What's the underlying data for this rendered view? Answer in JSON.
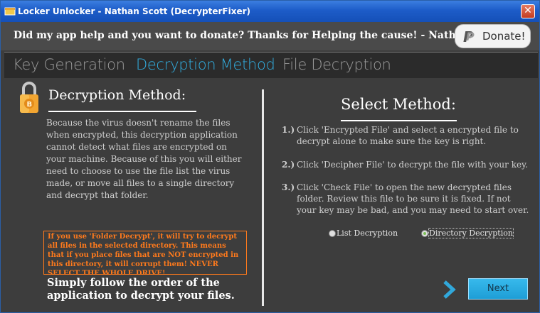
{
  "window": {
    "title": "Locker Unlocker - Nathan Scott (DecrypterFixer)",
    "close_label": "✕"
  },
  "banner": {
    "text": "Did my app help and you want to donate? Thanks for Helping the cause! - Nathan Scott",
    "donate_label": "Donate!"
  },
  "tabs": [
    {
      "label": "Key Generation",
      "active": false
    },
    {
      "label": "Decryption Method",
      "active": true
    },
    {
      "label": "File Decryption",
      "active": false
    }
  ],
  "left": {
    "heading": "Decryption Method:",
    "description": "Because the virus doesn't rename the files when encrypted, this decryption application cannot detect what files are encrypted on your machine. Because of this you will either need to choose to use the file list the virus made, or move all files to a single directory and decrypt that folder.",
    "warning": "If you use 'Folder Decrypt', it will try to decrypt all files in the selected directory. This means that if you place files that are NOT encrypted in this directory, it will corrupt them! NEVER SELECT THE WHOLE DRIVE!",
    "footer": "Simply follow the order of the application to decrypt your files."
  },
  "right": {
    "heading": "Select Method:",
    "steps": [
      {
        "num": "1.)",
        "text": "Click 'Encrypted File' and select a encrypted file to decrypt alone to make sure the key is right."
      },
      {
        "num": "2.)",
        "text": "Click 'Decipher File' to decrypt the file with your key."
      },
      {
        "num": "3.)",
        "text": "Click 'Check File' to open the new decrypted files folder. Review this file to be sure it is fixed. If not your key may be bad, and you may need to start over."
      }
    ],
    "options": [
      {
        "label": "List Decryption",
        "selected": false
      },
      {
        "label": "Directory Decryption",
        "selected": true
      }
    ]
  },
  "nav": {
    "next_label": "Next"
  },
  "colors": {
    "accent": "#32aee0",
    "warning": "#ff7a1c",
    "titlebar": "#1d5cc8"
  }
}
